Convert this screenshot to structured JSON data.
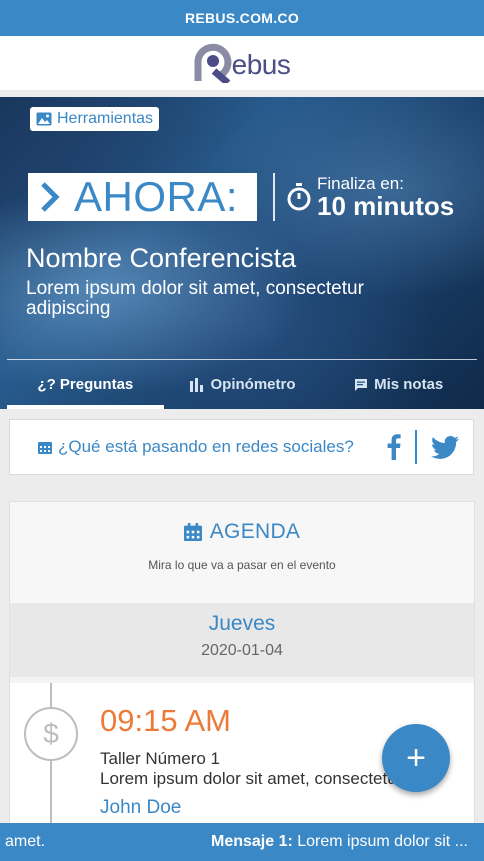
{
  "topbar": {
    "site": "REBUS.COM.CO"
  },
  "logo": {
    "text": "ebus"
  },
  "hero": {
    "tools_label": "Herramientas",
    "now_label": "AHORA:",
    "timer_label": "Finaliza en:",
    "timer_value": "10 minutos",
    "speaker_name": "Nombre Conferencista",
    "speaker_desc": "Lorem ipsum dolor sit amet, consectetur adipiscing",
    "tabs": [
      {
        "label": "¿? Preguntas"
      },
      {
        "label": "Opinómetro"
      },
      {
        "label": "Mis notas"
      }
    ]
  },
  "social": {
    "text": "¿Qué está pasando en redes sociales?"
  },
  "agenda": {
    "title": "AGENDA",
    "subtitle": "Mira lo que va a pasar en el evento",
    "day_name": "Jueves",
    "day_date": "2020-01-04",
    "event": {
      "time": "09:15 AM",
      "title": "Taller Número 1",
      "description": "Lorem ipsum dolor sit amet, consectetur",
      "speaker": "John Doe"
    }
  },
  "fab": {
    "label": "+"
  },
  "ticker": {
    "left_text": "amet.",
    "prefix": "Mensaje 1:",
    "message": " Lorem ipsum dolor sit ..."
  },
  "colors": {
    "accent": "#3b88c6",
    "time": "#ec7b3a",
    "logo": "#4b4e86"
  }
}
